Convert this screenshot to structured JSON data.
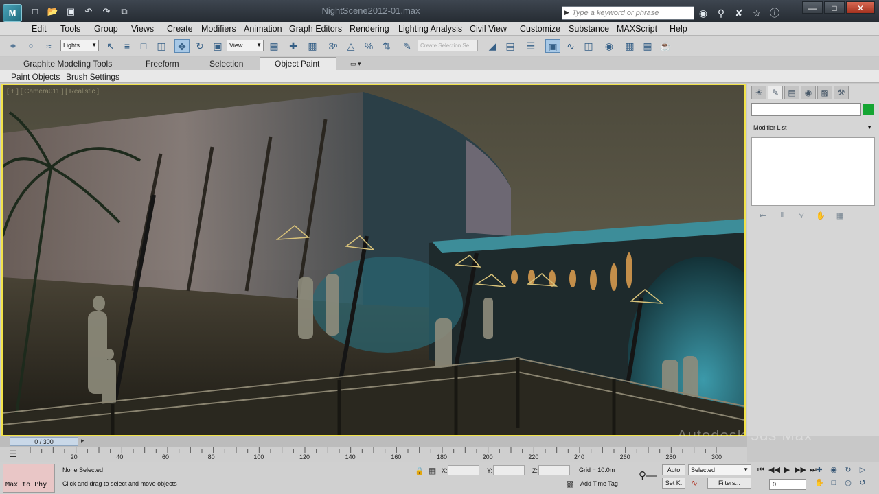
{
  "app": {
    "logo": "M",
    "window_title": "NightScene2012-01.max",
    "search_placeholder": "Type a keyword or phrase",
    "quick_access_icons": [
      "new-icon",
      "open-icon",
      "save-icon",
      "undo-icon",
      "redo-icon",
      "project-icon"
    ],
    "info_center_icons": [
      "binoculars-icon",
      "key-icon",
      "star-tools-icon",
      "favorites-icon",
      "help-icon"
    ],
    "window_controls": [
      "minimize",
      "maximize",
      "close"
    ]
  },
  "menu": {
    "items": [
      "Edit",
      "Tools",
      "Group",
      "Views",
      "Create",
      "Modifiers",
      "Animation",
      "Graph Editors",
      "Rendering",
      "Lighting Analysis",
      "Civil View",
      "Customize",
      "Substance",
      "MAXScript",
      "Help"
    ]
  },
  "toolbar": {
    "selection_filter": "Lights",
    "reference_coord": "View",
    "named_selection_placeholder": "Create Selection Se"
  },
  "ribbon": {
    "title": "Graphite Modeling Tools",
    "tabs": [
      "Freeform",
      "Selection",
      "Object Paint"
    ],
    "active_tab": "Object Paint",
    "sub_tabs": [
      "Paint Objects",
      "Brush Settings"
    ]
  },
  "viewport": {
    "label": "[ + ] [ Camera011 ] [ Realistic ]",
    "border_color": "#f1e24a"
  },
  "command_panel": {
    "tabs": [
      "create-icon",
      "modify-icon",
      "hierarchy-icon",
      "motion-icon",
      "display-icon",
      "utilities-icon"
    ],
    "modifier_list_label": "Modifier List",
    "object_color": "#14a532"
  },
  "timeline": {
    "frame_counter": "0 / 300",
    "ticks": [
      20,
      40,
      60,
      80,
      100,
      120,
      140,
      160,
      180,
      200,
      220,
      240,
      260,
      280,
      300
    ]
  },
  "status": {
    "listener_text": "Max to Phy",
    "selection_status": "None Selected",
    "prompt": "Click and drag to select and move objects",
    "coord_labels": [
      "X:",
      "Y:",
      "Z:"
    ],
    "grid": "Grid = 10.0m",
    "add_time_tag": "Add Time Tag",
    "auto_key": "Auto",
    "set_key": "Set K.",
    "key_filter": "Selected",
    "filters": "Filters...",
    "current_frame": "0"
  },
  "watermark": "Autodesk 3ds Max"
}
